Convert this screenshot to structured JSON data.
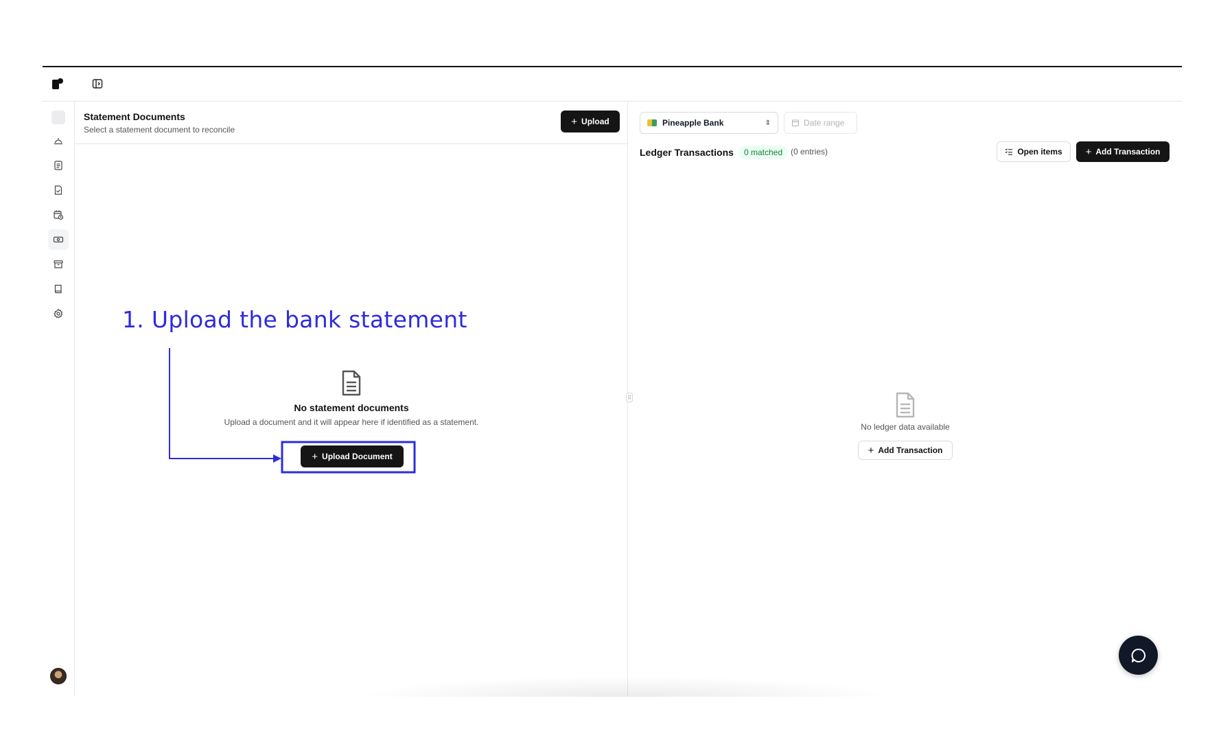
{
  "sidebar": {
    "items": [
      {
        "icon": "placeholder-square"
      },
      {
        "icon": "hat-icon"
      },
      {
        "icon": "document-icon"
      },
      {
        "icon": "document-check-icon"
      },
      {
        "icon": "calendar-clock-icon"
      },
      {
        "icon": "banknote-icon",
        "active": true
      },
      {
        "icon": "archive-icon"
      },
      {
        "icon": "book-icon"
      },
      {
        "icon": "gear-icon"
      }
    ]
  },
  "statements": {
    "title": "Statement Documents",
    "subtitle": "Select a statement document to reconcile",
    "upload_label": "Upload",
    "empty_title": "No statement documents",
    "empty_desc": "Upload a document and it will appear here if identified as a statement.",
    "upload_document_label": "Upload Document"
  },
  "ledger": {
    "bank_select": "Pineapple Bank",
    "date_range_placeholder": "Date range",
    "title": "Ledger Transactions",
    "matched_badge": "0 matched",
    "entries": "(0 entries)",
    "open_items_label": "Open items",
    "add_transaction_label": "Add Transaction",
    "empty_desc": "No ledger data available",
    "empty_add_transaction_label": "Add Transaction"
  },
  "annotation": {
    "step_text": "1. Upload the bank statement",
    "color": "#2e2cdb"
  },
  "colors": {
    "button_dark": "#151515",
    "badge_green_bg": "#ecfdf3",
    "badge_green_text": "#15803d",
    "chat_fab": "#111827"
  }
}
